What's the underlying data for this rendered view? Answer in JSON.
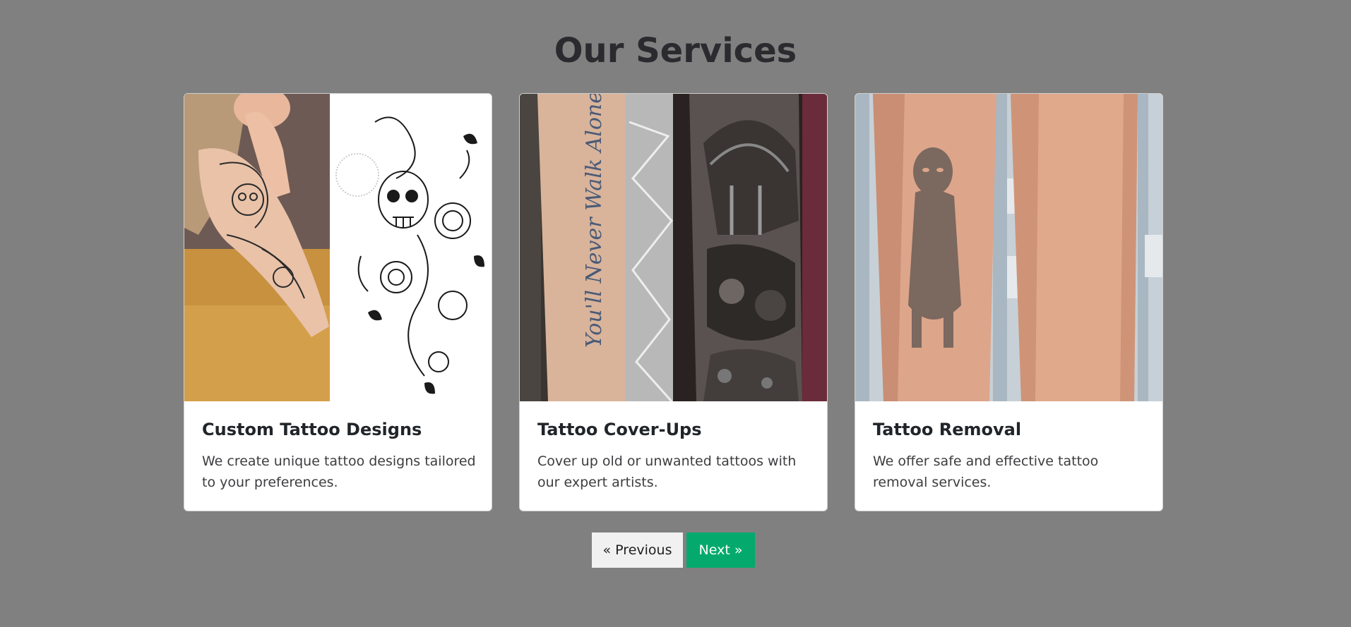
{
  "page": {
    "title": "Our Services"
  },
  "cards": [
    {
      "title": "Custom Tattoo Designs",
      "text": "We create unique tattoo designs tailored to your preferences.",
      "image_icon": "tattoo-design-photo"
    },
    {
      "title": "Tattoo Cover-Ups",
      "text": "Cover up old or unwanted tattoos with our expert artists.",
      "image_icon": "tattoo-coverup-photo",
      "image_text": "You'll Never Walk Alone"
    },
    {
      "title": "Tattoo Removal",
      "text": "We offer safe and effective tattoo removal services.",
      "image_icon": "tattoo-removal-photo"
    }
  ],
  "pagination": {
    "previous_label": "« Previous",
    "next_label": "Next »"
  },
  "colors": {
    "background": "#808080",
    "card_background": "#ffffff",
    "next_button": "#04aa6d",
    "previous_button": "#f1f1f1"
  }
}
